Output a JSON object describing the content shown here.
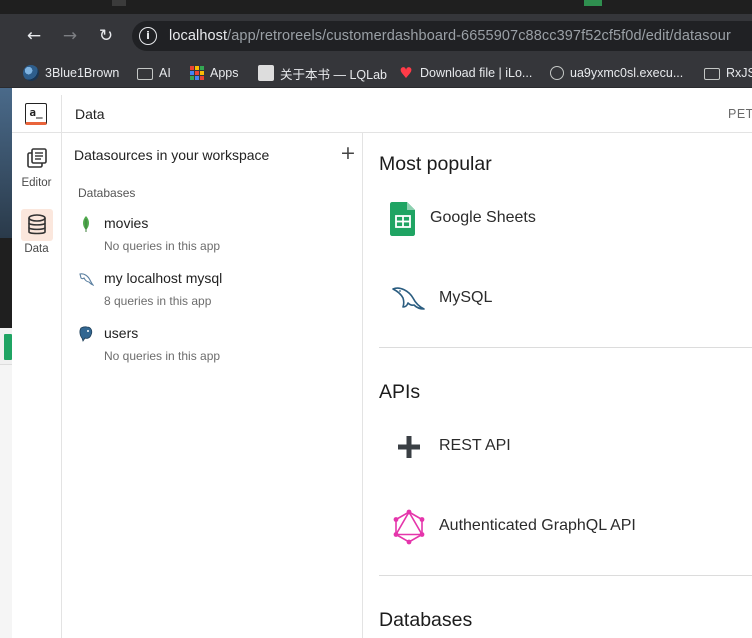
{
  "browser": {
    "back_icon": "arrow-left-icon",
    "forward_icon": "arrow-right-icon",
    "reload_icon": "reload-icon",
    "url_host": "localhost",
    "url_path": "/app/retroreels/customerdashboard-6655907c88cc397f52cf5f0d/edit/datasour",
    "bookmarks": [
      {
        "label": "3Blue1Brown",
        "icon": "pi-creature-icon"
      },
      {
        "label": "AI",
        "icon": "folder-icon"
      },
      {
        "label": "Apps",
        "icon": "apps-grid-icon"
      },
      {
        "label": "关于本书 — LQLab",
        "icon": "cat-avatar-icon"
      },
      {
        "label": "Download file | iLo...",
        "icon": "heart-icon"
      },
      {
        "label": "ua9yxmc0sl.execu...",
        "icon": "globe-icon"
      },
      {
        "label": "RxJS",
        "icon": "folder-icon"
      }
    ]
  },
  "app": {
    "logo_text": "a_",
    "page_title": "Data",
    "header_right": "PET",
    "rail": [
      {
        "label": "Editor",
        "icon": "editor-pages-icon",
        "active": false
      },
      {
        "label": "Data",
        "icon": "database-icon",
        "active": true
      }
    ],
    "datasources_panel": {
      "title": "Datasources in your workspace",
      "add_icon": "plus-icon",
      "section": "Databases",
      "items": [
        {
          "name": "movies",
          "subtitle": "No queries in this app",
          "icon": "mongodb-leaf-icon"
        },
        {
          "name": "my localhost mysql",
          "subtitle": "8 queries in this app",
          "icon": "mysql-dolphin-icon"
        },
        {
          "name": "users",
          "subtitle": "No queries in this app",
          "icon": "postgres-elephant-icon"
        }
      ]
    },
    "main": {
      "sections": [
        {
          "title": "Most popular",
          "items": [
            {
              "name": "Google Sheets",
              "icon": "google-sheets-icon"
            },
            {
              "name": "MySQL",
              "icon": "mysql-dolphin-icon"
            }
          ]
        },
        {
          "title": "APIs",
          "items": [
            {
              "name": "REST API",
              "icon": "plus-cross-icon"
            },
            {
              "name": "Authenticated GraphQL API",
              "icon": "graphql-icon"
            }
          ]
        },
        {
          "title": "Databases",
          "items": []
        }
      ]
    },
    "colors": {
      "accent": "#e9643b",
      "active_rail_bg": "#fbe7dd",
      "sheets_green": "#1fa463",
      "mysql_blue": "#2b5d80",
      "graphql_pink": "#e535ab",
      "mongodb_green": "#4fa94d"
    }
  }
}
